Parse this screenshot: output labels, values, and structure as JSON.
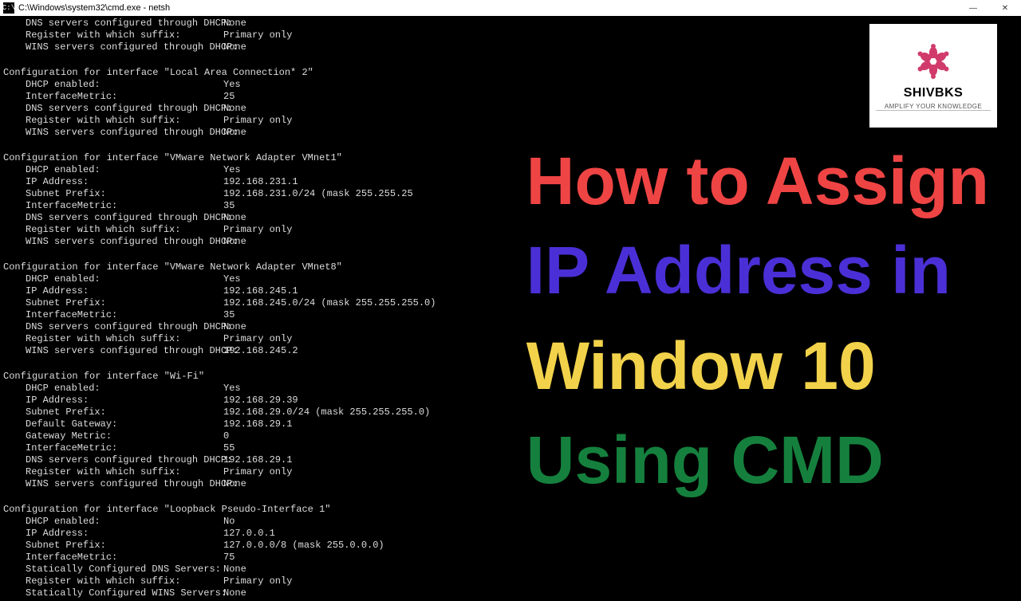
{
  "titlebar": {
    "icon_text": "C:\\",
    "title": "C:\\Windows\\system32\\cmd.exe - netsh",
    "min": "—",
    "close": "✕"
  },
  "top_lines": [
    {
      "k": "DNS servers configured through DHCP:",
      "v": "None"
    },
    {
      "k": "Register with which suffix:",
      "v": "Primary only"
    },
    {
      "k": "WINS servers configured through DHCP:",
      "v": "None"
    }
  ],
  "sections": [
    {
      "header": "Configuration for interface \"Local Area Connection* 2\"",
      "rows": [
        {
          "k": "DHCP enabled:",
          "v": "Yes"
        },
        {
          "k": "InterfaceMetric:",
          "v": "25"
        },
        {
          "k": "DNS servers configured through DHCP:",
          "v": "None"
        },
        {
          "k": "Register with which suffix:",
          "v": "Primary only"
        },
        {
          "k": "WINS servers configured through DHCP:",
          "v": "None"
        }
      ]
    },
    {
      "header": "Configuration for interface \"VMware Network Adapter VMnet1\"",
      "rows": [
        {
          "k": "DHCP enabled:",
          "v": "Yes"
        },
        {
          "k": "IP Address:",
          "v": "192.168.231.1"
        },
        {
          "k": "Subnet Prefix:",
          "v": "192.168.231.0/24 (mask 255.255.25"
        },
        {
          "k": "InterfaceMetric:",
          "v": "35"
        },
        {
          "k": "DNS servers configured through DHCP:",
          "v": "None"
        },
        {
          "k": "Register with which suffix:",
          "v": "Primary only"
        },
        {
          "k": "WINS servers configured through DHCP:",
          "v": "None"
        }
      ]
    },
    {
      "header": "Configuration for interface \"VMware Network Adapter VMnet8\"",
      "rows": [
        {
          "k": "DHCP enabled:",
          "v": "Yes"
        },
        {
          "k": "IP Address:",
          "v": "192.168.245.1"
        },
        {
          "k": "Subnet Prefix:",
          "v": "192.168.245.0/24 (mask 255.255.255.0)"
        },
        {
          "k": "InterfaceMetric:",
          "v": "35"
        },
        {
          "k": "DNS servers configured through DHCP:",
          "v": "None"
        },
        {
          "k": "Register with which suffix:",
          "v": "Primary only"
        },
        {
          "k": "WINS servers configured through DHCP:",
          "v": "192.168.245.2"
        }
      ]
    },
    {
      "header": "Configuration for interface \"Wi-Fi\"",
      "rows": [
        {
          "k": "DHCP enabled:",
          "v": "Yes"
        },
        {
          "k": "IP Address:",
          "v": "192.168.29.39"
        },
        {
          "k": "Subnet Prefix:",
          "v": "192.168.29.0/24 (mask 255.255.255.0)"
        },
        {
          "k": "Default Gateway:",
          "v": "192.168.29.1"
        },
        {
          "k": "Gateway Metric:",
          "v": "0"
        },
        {
          "k": "InterfaceMetric:",
          "v": "55"
        },
        {
          "k": "DNS servers configured through DHCP:",
          "v": "192.168.29.1"
        },
        {
          "k": "Register with which suffix:",
          "v": "Primary only"
        },
        {
          "k": "WINS servers configured through DHCP:",
          "v": "None"
        }
      ]
    },
    {
      "header": "Configuration for interface \"Loopback Pseudo-Interface 1\"",
      "rows": [
        {
          "k": "DHCP enabled:",
          "v": "No"
        },
        {
          "k": "IP Address:",
          "v": "127.0.0.1"
        },
        {
          "k": "Subnet Prefix:",
          "v": "127.0.0.0/8 (mask 255.0.0.0)"
        },
        {
          "k": "InterfaceMetric:",
          "v": "75"
        },
        {
          "k": "Statically Configured DNS Servers:",
          "v": "None"
        },
        {
          "k": "Register with which suffix:",
          "v": "Primary only"
        },
        {
          "k": "Statically Configured WINS Servers:",
          "v": "None"
        }
      ]
    }
  ],
  "overlay": {
    "l1": "How to Assign",
    "l2": "IP Address in",
    "l3": "Window 10",
    "l4": "Using CMD"
  },
  "logo": {
    "brand": "SHIVBKS",
    "tagline": "AMPLIFY YOUR KNOWLEDGE"
  }
}
